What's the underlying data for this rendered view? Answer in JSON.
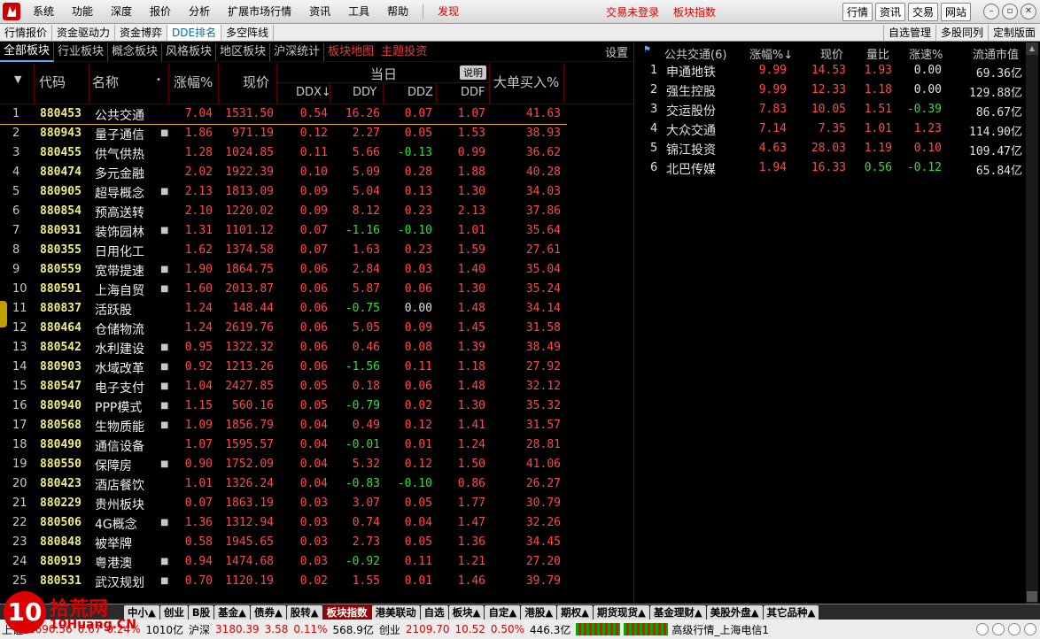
{
  "menubar": {
    "items": [
      "系统",
      "功能",
      "深度",
      "报价",
      "分析",
      "扩展市场行情",
      "资讯",
      "工具",
      "帮助"
    ],
    "find": "发现",
    "status": [
      "交易未登录",
      "板块指数"
    ],
    "buttons": [
      "行情",
      "资讯",
      "交易",
      "网站"
    ]
  },
  "toolbar2": {
    "left": [
      "行情报价",
      "资金驱动力",
      "资金博弈",
      "DDE排名",
      "多空阵线"
    ],
    "right": [
      "自选管理",
      "多股同列",
      "定制版面"
    ]
  },
  "tabs": {
    "items": [
      "全部板块",
      "行业板块",
      "概念板块",
      "风格板块",
      "地区板块",
      "沪深统计"
    ],
    "red_items": [
      "板块地图",
      "主题投资"
    ],
    "settings": "设置"
  },
  "header": {
    "code": "代码",
    "name": "名称",
    "chg": "涨幅%",
    "price": "现价",
    "today": "当日",
    "explain": "说明",
    "ddx": "DDX↓",
    "ddy": "DDY",
    "ddz": "DDZ",
    "ddf": "DDF",
    "big": "大单买入%"
  },
  "rows": [
    {
      "idx": "1",
      "code": "880453",
      "name": "公共交通",
      "dot": "",
      "chg": "7.04",
      "price": "1531.50",
      "ddx": "0.54",
      "ddy": "16.26",
      "ddz": "0.07",
      "ddf": "1.07",
      "big": "41.63"
    },
    {
      "idx": "2",
      "code": "880943",
      "name": "量子通信",
      "dot": "■",
      "chg": "1.86",
      "price": "971.19",
      "ddx": "0.12",
      "ddy": "2.27",
      "ddz": "0.05",
      "ddf": "1.53",
      "big": "38.93"
    },
    {
      "idx": "3",
      "code": "880455",
      "name": "供气供热",
      "dot": "",
      "chg": "1.28",
      "price": "1024.85",
      "ddx": "0.11",
      "ddy": "5.66",
      "ddz": "-0.13",
      "ddf": "0.99",
      "big": "36.62"
    },
    {
      "idx": "4",
      "code": "880474",
      "name": "多元金融",
      "dot": "",
      "chg": "2.02",
      "price": "1922.39",
      "ddx": "0.10",
      "ddy": "5.09",
      "ddz": "0.28",
      "ddf": "1.88",
      "big": "40.28"
    },
    {
      "idx": "5",
      "code": "880905",
      "name": "超导概念",
      "dot": "■",
      "chg": "2.13",
      "price": "1813.09",
      "ddx": "0.09",
      "ddy": "5.04",
      "ddz": "0.13",
      "ddf": "1.30",
      "big": "34.03"
    },
    {
      "idx": "6",
      "code": "880854",
      "name": "预高送转",
      "dot": "",
      "chg": "2.10",
      "price": "1220.02",
      "ddx": "0.09",
      "ddy": "8.12",
      "ddz": "0.23",
      "ddf": "2.13",
      "big": "37.86"
    },
    {
      "idx": "7",
      "code": "880931",
      "name": "装饰园林",
      "dot": "■",
      "chg": "1.31",
      "price": "1101.12",
      "ddx": "0.07",
      "ddy": "-1.16",
      "ddz": "-0.10",
      "ddf": "1.01",
      "big": "35.64"
    },
    {
      "idx": "8",
      "code": "880355",
      "name": "日用化工",
      "dot": "",
      "chg": "1.62",
      "price": "1374.58",
      "ddx": "0.07",
      "ddy": "1.63",
      "ddz": "0.23",
      "ddf": "1.59",
      "big": "27.61"
    },
    {
      "idx": "9",
      "code": "880559",
      "name": "宽带提速",
      "dot": "■",
      "chg": "1.90",
      "price": "1864.75",
      "ddx": "0.06",
      "ddy": "2.84",
      "ddz": "0.03",
      "ddf": "1.40",
      "big": "35.04"
    },
    {
      "idx": "10",
      "code": "880591",
      "name": "上海自贸",
      "dot": "■",
      "chg": "1.60",
      "price": "2013.87",
      "ddx": "0.06",
      "ddy": "5.87",
      "ddz": "0.06",
      "ddf": "1.30",
      "big": "35.24"
    },
    {
      "idx": "11",
      "code": "880837",
      "name": "活跃股",
      "dot": "",
      "chg": "1.24",
      "price": "148.44",
      "ddx": "0.06",
      "ddy": "-0.75",
      "ddz": "0.00",
      "ddf": "1.48",
      "big": "34.14"
    },
    {
      "idx": "12",
      "code": "880464",
      "name": "仓储物流",
      "dot": "",
      "chg": "1.24",
      "price": "2619.76",
      "ddx": "0.06",
      "ddy": "5.05",
      "ddz": "0.09",
      "ddf": "1.45",
      "big": "31.58"
    },
    {
      "idx": "13",
      "code": "880542",
      "name": "水利建设",
      "dot": "■",
      "chg": "0.95",
      "price": "1322.32",
      "ddx": "0.06",
      "ddy": "0.46",
      "ddz": "0.08",
      "ddf": "1.39",
      "big": "38.49"
    },
    {
      "idx": "14",
      "code": "880903",
      "name": "水域改革",
      "dot": "■",
      "chg": "0.92",
      "price": "1213.26",
      "ddx": "0.06",
      "ddy": "-1.56",
      "ddz": "0.11",
      "ddf": "1.18",
      "big": "27.92"
    },
    {
      "idx": "15",
      "code": "880547",
      "name": "电子支付",
      "dot": "■",
      "chg": "1.04",
      "price": "2427.85",
      "ddx": "0.05",
      "ddy": "0.18",
      "ddz": "0.06",
      "ddf": "1.48",
      "big": "32.12"
    },
    {
      "idx": "16",
      "code": "880940",
      "name": "PPP模式",
      "dot": "■",
      "chg": "1.15",
      "price": "560.16",
      "ddx": "0.05",
      "ddy": "-0.79",
      "ddz": "0.02",
      "ddf": "1.30",
      "big": "35.32"
    },
    {
      "idx": "17",
      "code": "880568",
      "name": "生物质能",
      "dot": "■",
      "chg": "1.09",
      "price": "1856.79",
      "ddx": "0.04",
      "ddy": "0.49",
      "ddz": "0.12",
      "ddf": "1.41",
      "big": "31.57"
    },
    {
      "idx": "18",
      "code": "880490",
      "name": "通信设备",
      "dot": "",
      "chg": "1.07",
      "price": "1595.57",
      "ddx": "0.04",
      "ddy": "-0.01",
      "ddz": "0.01",
      "ddf": "1.24",
      "big": "28.81"
    },
    {
      "idx": "19",
      "code": "880550",
      "name": "保障房",
      "dot": "■",
      "chg": "0.90",
      "price": "1752.09",
      "ddx": "0.04",
      "ddy": "5.32",
      "ddz": "0.12",
      "ddf": "1.50",
      "big": "41.06"
    },
    {
      "idx": "20",
      "code": "880423",
      "name": "酒店餐饮",
      "dot": "",
      "chg": "1.01",
      "price": "1326.24",
      "ddx": "0.04",
      "ddy": "-0.83",
      "ddz": "-0.10",
      "ddf": "0.86",
      "big": "26.27"
    },
    {
      "idx": "21",
      "code": "880229",
      "name": "贵州板块",
      "dot": "",
      "chg": "0.07",
      "price": "1863.19",
      "ddx": "0.03",
      "ddy": "3.07",
      "ddz": "0.05",
      "ddf": "1.77",
      "big": "30.79"
    },
    {
      "idx": "22",
      "code": "880506",
      "name": "4G概念",
      "dot": "■",
      "chg": "1.36",
      "price": "1312.94",
      "ddx": "0.03",
      "ddy": "0.74",
      "ddz": "0.04",
      "ddf": "1.47",
      "big": "32.26"
    },
    {
      "idx": "23",
      "code": "880848",
      "name": "被举牌",
      "dot": "",
      "chg": "0.58",
      "price": "1945.65",
      "ddx": "0.03",
      "ddy": "2.73",
      "ddz": "0.05",
      "ddf": "1.36",
      "big": "34.45"
    },
    {
      "idx": "24",
      "code": "880919",
      "name": "粤港澳",
      "dot": "■",
      "chg": "0.94",
      "price": "1474.68",
      "ddx": "0.03",
      "ddy": "-0.92",
      "ddz": "0.11",
      "ddf": "1.21",
      "big": "27.20"
    },
    {
      "idx": "25",
      "code": "880531",
      "name": "武汉规划",
      "dot": "■",
      "chg": "0.70",
      "price": "1120.19",
      "ddx": "0.02",
      "ddy": "1.55",
      "ddz": "0.01",
      "ddf": "1.46",
      "big": "39.79"
    }
  ],
  "right_panel": {
    "title": "公共交通(6)",
    "headers": [
      "涨幅%↓",
      "现价",
      "量比",
      "涨速%",
      "流通市值"
    ],
    "rows": [
      {
        "idx": "1",
        "name": "申通地铁",
        "chg": "9.99",
        "price": "14.53",
        "vr": "1.93",
        "speed": "0.00",
        "cap": "69.36亿"
      },
      {
        "idx": "2",
        "name": "强生控股",
        "chg": "9.99",
        "price": "12.33",
        "vr": "1.18",
        "speed": "0.00",
        "cap": "129.88亿"
      },
      {
        "idx": "3",
        "name": "交运股份",
        "chg": "7.83",
        "price": "10.05",
        "vr": "1.51",
        "speed": "-0.39",
        "cap": "86.67亿"
      },
      {
        "idx": "4",
        "name": "大众交通",
        "chg": "7.14",
        "price": "7.35",
        "vr": "1.01",
        "speed": "1.23",
        "cap": "114.90亿"
      },
      {
        "idx": "5",
        "name": "锦江投资",
        "chg": "4.63",
        "price": "28.03",
        "vr": "1.19",
        "speed": "0.10",
        "cap": "109.47亿"
      },
      {
        "idx": "6",
        "name": "北巴传媒",
        "chg": "1.94",
        "price": "16.33",
        "vr": "0.56",
        "speed": "-0.12",
        "cap": "65.84亿"
      }
    ]
  },
  "bottom_tabs": [
    "中小▲",
    "创业",
    "B股",
    "基金▲",
    "债券▲",
    "股转▲",
    "板块指数",
    "港美联动",
    "自选",
    "板块▲",
    "自定▲",
    "港股▲",
    "期权▲",
    "期货现货▲",
    "基金理财▲",
    "美股外盘▲",
    "其它品种▲"
  ],
  "active_bottom_tab": "板块指数",
  "statusbar": {
    "sh_label": "上证",
    "sh_val": "2690.56",
    "sh_chg": "6.67",
    "sh_pct": "0.24%",
    "sh_amt": "1010亿",
    "sz_label": "沪深",
    "sz_val": "3180.39",
    "sz_chg": "3.58",
    "sz_pct": "0.11%",
    "sz_amt": "568.9亿",
    "cy_label": "创业",
    "cy_val": "2109.70",
    "cy_chg": "10.52",
    "cy_pct": "0.50%",
    "cy_amt": "446.3亿",
    "server": "高级行情_上海电信1"
  },
  "watermark": {
    "logo": "10",
    "cn": "拾荒网",
    "en": "10Huang.CN"
  }
}
